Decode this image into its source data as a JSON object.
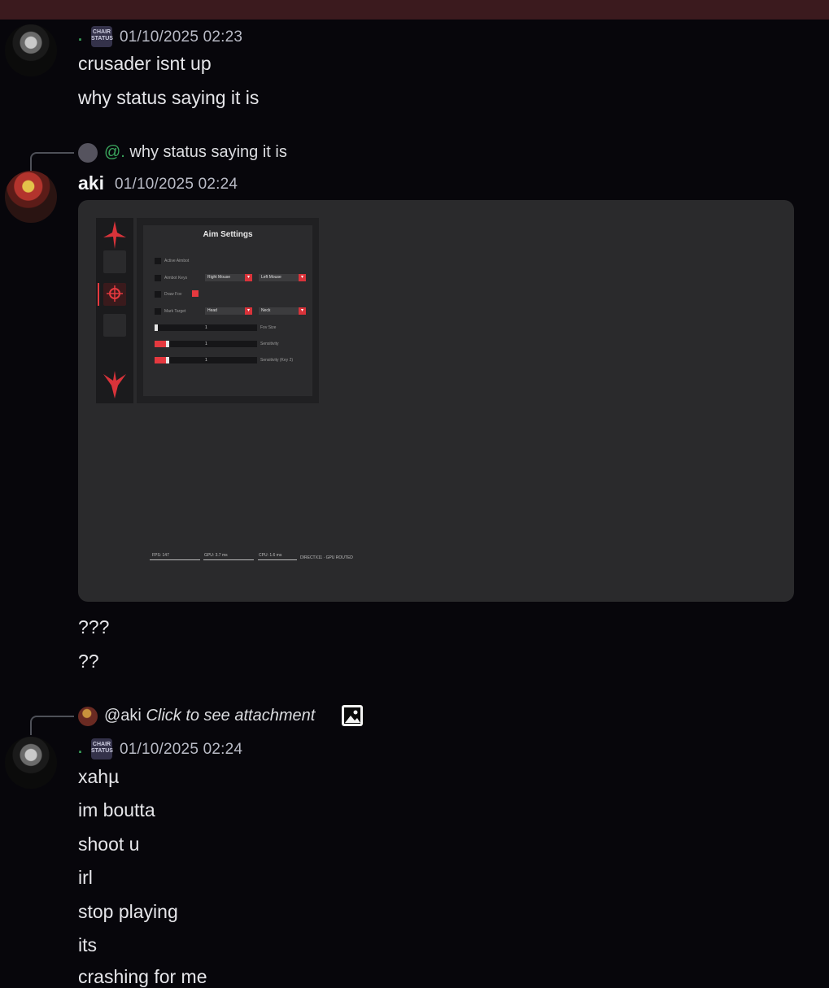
{
  "colors": {
    "background": "#07060b",
    "top_bar": "#3b1a1e",
    "mention": "#3ba55d",
    "accent_red": "#e5393f"
  },
  "messages": [
    {
      "author_tag": ".",
      "badge_text": "CHAIR STATUS",
      "timestamp": "01/10/2025 02:23",
      "lines": [
        "crusader isnt up",
        "why status saying it is"
      ]
    },
    {
      "reply": {
        "mention": "@.",
        "text": " why status saying it is"
      },
      "author": "aki",
      "timestamp": "01/10/2025 02:24",
      "attachment": {
        "panel_title": "Aim Settings",
        "rows": [
          {
            "label": "Active Aimbot"
          },
          {
            "label": "Aimbot Keys",
            "dropdowns": [
              "Right Mouse",
              "Left Mouse"
            ]
          },
          {
            "label": "Draw Fov"
          },
          {
            "label": "Mark Target",
            "dropdowns": [
              "Head",
              "Neck"
            ]
          }
        ],
        "sliders": [
          {
            "value_label": "1",
            "name": "Fov Size",
            "level": 0.02
          },
          {
            "value_label": "1",
            "name": "Sensitivity",
            "level": 0.14
          },
          {
            "value_label": "1",
            "name": "Sensitivity (Key 2)",
            "level": 0.14
          }
        ],
        "perf_labels": [
          "FPS: 147",
          "GPU: 3.7 ms",
          "CPU: 1.6 ms",
          "DIRECTX11 · GPU ROUTED"
        ]
      },
      "lines": [
        "???",
        "??"
      ]
    },
    {
      "reply": {
        "mention": "@aki",
        "text": "Click to see attachment",
        "icon": "image-icon"
      },
      "author_tag": ".",
      "badge_text": "CHAIR STATUS",
      "timestamp": "01/10/2025 02:24",
      "lines": [
        "xahµ",
        "im boutta",
        "shoot u",
        "irl",
        "stop playing",
        "its",
        "crashing for me"
      ]
    }
  ]
}
